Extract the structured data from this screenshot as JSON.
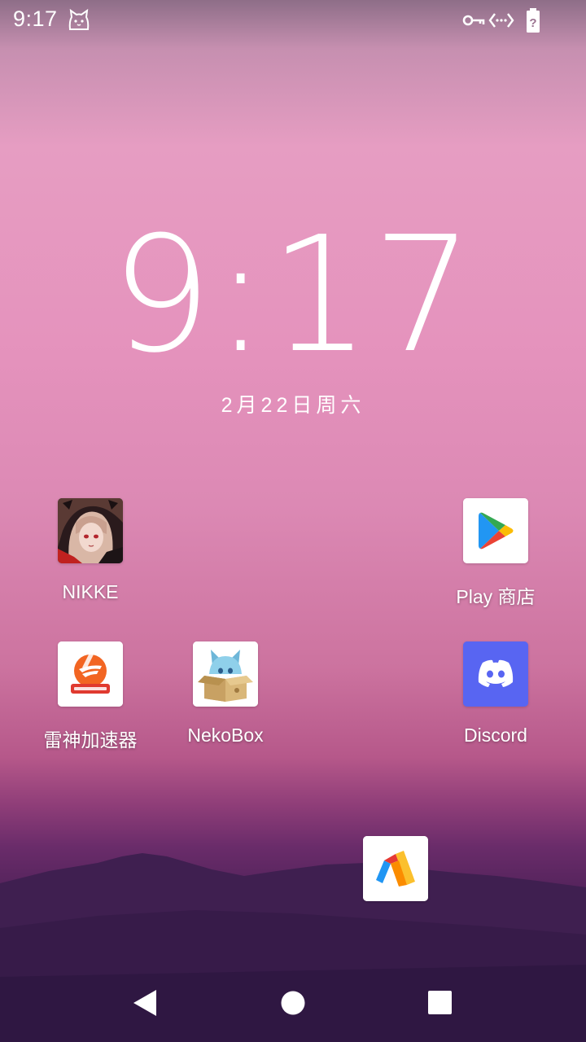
{
  "status_bar": {
    "time": "9:17",
    "icons": [
      "cat-icon",
      "vpn-key-icon",
      "vpn-arrows-icon",
      "battery-unknown-icon"
    ]
  },
  "clock": {
    "time": "9:17",
    "date": "2月22日周六"
  },
  "apps": [
    {
      "label": "NIKKE",
      "icon": "nikke-app-icon"
    },
    {
      "label": "Play 商店",
      "icon": "play-store-icon"
    },
    {
      "label": "雷神加速器",
      "icon": "leishen-accelerator-icon"
    },
    {
      "label": "NekoBox",
      "icon": "nekobox-icon"
    },
    {
      "label": "Discord",
      "icon": "discord-icon"
    },
    {
      "label": "",
      "icon": "unlabeled-app-icon"
    }
  ],
  "nav_bar": {
    "buttons": [
      "back-icon",
      "home-icon",
      "recents-icon"
    ]
  },
  "colors": {
    "discord": "#5865f2",
    "leishen_orange": "#f26522",
    "wallpaper_top": "#e69dc2",
    "wallpaper_bottom": "#2e1640"
  }
}
